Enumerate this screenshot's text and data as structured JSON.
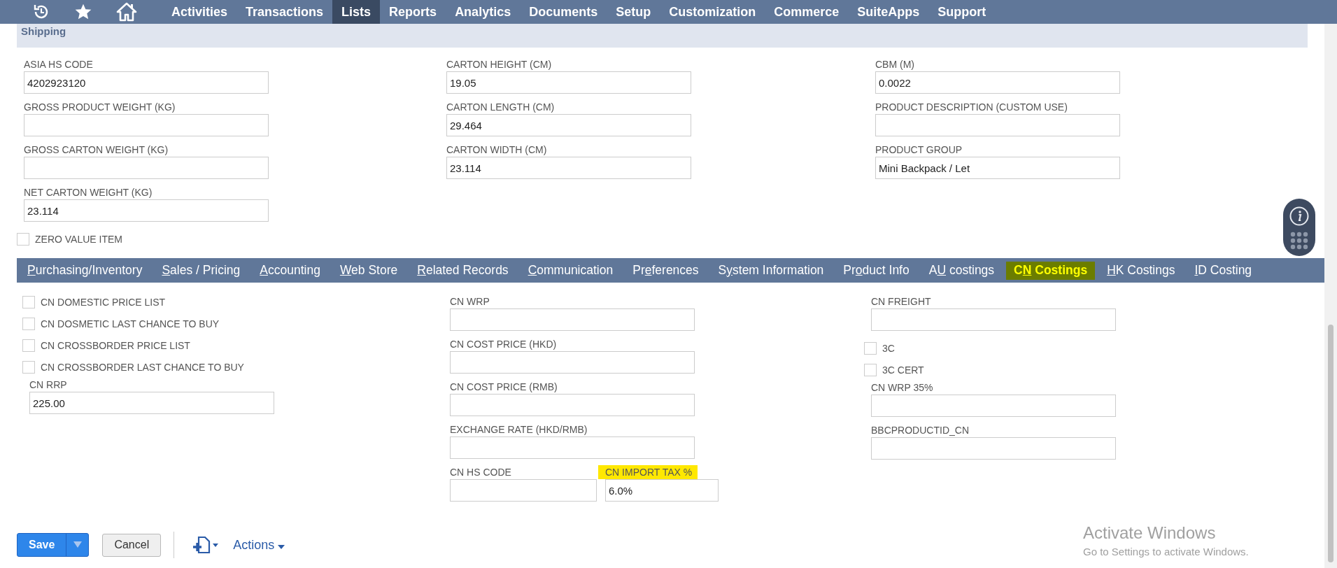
{
  "nav": {
    "items": [
      {
        "label": "Activities",
        "selected": false
      },
      {
        "label": "Transactions",
        "selected": false
      },
      {
        "label": "Lists",
        "selected": true
      },
      {
        "label": "Reports",
        "selected": false
      },
      {
        "label": "Analytics",
        "selected": false
      },
      {
        "label": "Documents",
        "selected": false
      },
      {
        "label": "Setup",
        "selected": false
      },
      {
        "label": "Customization",
        "selected": false
      },
      {
        "label": "Commerce",
        "selected": false
      },
      {
        "label": "SuiteApps",
        "selected": false
      },
      {
        "label": "Support",
        "selected": false
      }
    ]
  },
  "shipping": {
    "title": "Shipping",
    "columns": [
      [
        {
          "kind": "text",
          "label": "ASIA HS CODE",
          "value": "4202923120"
        },
        {
          "kind": "text",
          "label": "GROSS PRODUCT WEIGHT (KG)"
        },
        {
          "kind": "text",
          "label": "GROSS CARTON WEIGHT (KG)"
        },
        {
          "kind": "text",
          "label": "NET CARTON WEIGHT (KG)",
          "value": "23.114"
        },
        {
          "kind": "checkbox",
          "label": "ZERO VALUE ITEM",
          "checked": false
        }
      ],
      [
        {
          "kind": "text",
          "label": "CARTON HEIGHT (CM)",
          "value": "19.05"
        },
        {
          "kind": "text",
          "label": "CARTON LENGTH (CM)",
          "value": "29.464"
        },
        {
          "kind": "text",
          "label": "CARTON WIDTH (CM)",
          "value": "23.114"
        }
      ],
      [
        {
          "kind": "text",
          "label": "CBM (M)",
          "value": "0.0022"
        },
        {
          "kind": "text",
          "label": "PRODUCT DESCRIPTION (CUSTOM USE)"
        },
        {
          "kind": "text",
          "label": "PRODUCT GROUP",
          "value": "Mini Backpack / Let"
        }
      ]
    ]
  },
  "tabs": [
    {
      "key": "P",
      "post": "urchasing/Inventory",
      "selected": false
    },
    {
      "key": "S",
      "post": "ales / Pricing",
      "selected": false
    },
    {
      "key": "A",
      "post": "ccounting",
      "selected": false
    },
    {
      "key": "W",
      "post": "eb Store",
      "selected": false
    },
    {
      "key": "R",
      "post": "elated Records",
      "selected": false
    },
    {
      "key": "C",
      "post": "ommunication",
      "selected": false
    },
    {
      "pre": "Pr",
      "key": "e",
      "post": "ferences",
      "selected": false
    },
    {
      "pre": "S",
      "key": "y",
      "post": "stem Information",
      "selected": false
    },
    {
      "pre": "Pr",
      "key": "o",
      "post": "duct Info",
      "selected": false
    },
    {
      "pre": "A",
      "key": "U",
      "post": " costings",
      "selected": false
    },
    {
      "pre": "C",
      "key": "N",
      "post": " Costings",
      "selected": true
    },
    {
      "key": "H",
      "post": "K Costings",
      "selected": false
    },
    {
      "key": "I",
      "post": "D Costing",
      "selected": false
    }
  ],
  "cn_costings": {
    "columns": [
      [
        {
          "kind": "checkbox",
          "label": "CN DOMESTIC PRICE LIST",
          "checked": false
        },
        {
          "kind": "checkbox",
          "label": "CN DOSMETIC LAST CHANCE TO BUY",
          "checked": false
        },
        {
          "kind": "checkbox",
          "label": "CN CROSSBORDER PRICE LIST",
          "checked": false
        },
        {
          "kind": "checkbox",
          "label": "CN CROSSBORDER LAST CHANCE TO BUY",
          "checked": false
        },
        {
          "kind": "text",
          "label": "CN RRP",
          "value": "225.00"
        }
      ],
      [
        {
          "kind": "text",
          "label": "CN WRP"
        },
        {
          "kind": "text",
          "label": "CN COST PRICE (HKD)"
        },
        {
          "kind": "text",
          "label": "CN COST PRICE (RMB)"
        },
        {
          "kind": "text",
          "label": "EXCHANGE RATE (HKD/RMB)"
        },
        {
          "kind": "pair",
          "fields": [
            {
              "label": "CN HS CODE",
              "highlighted": false
            },
            {
              "label": "CN IMPORT TAX %",
              "value": "6.0%",
              "highlighted": true
            }
          ]
        }
      ],
      [
        {
          "kind": "text",
          "label": "CN FREIGHT"
        },
        {
          "kind": "checkbox",
          "label": "3C",
          "checked": false
        },
        {
          "kind": "checkbox",
          "label": "3C CERT",
          "checked": false
        },
        {
          "kind": "text",
          "label": "CN WRP 35%"
        },
        {
          "kind": "text",
          "label": "BBCPRODUCTID_CN"
        }
      ]
    ]
  },
  "footer": {
    "save": "Save",
    "cancel": "Cancel",
    "actions": "Actions"
  },
  "os_notice": {
    "title": "Activate Windows",
    "subtitle": "Go to Settings to activate Windows."
  }
}
